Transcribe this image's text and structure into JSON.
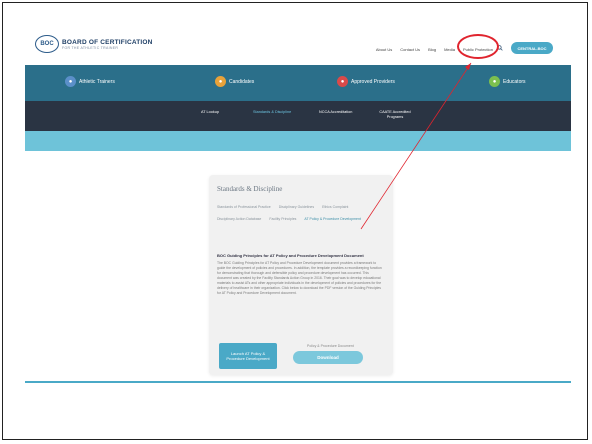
{
  "header": {
    "logo_mark": "BOC",
    "logo_name": "BOARD OF CERTIFICATION",
    "logo_sub": "FOR THE ATHLETIC TRAINER",
    "nav": [
      "About Us",
      "Contact Us",
      "Blog",
      "Media",
      "Public Protection"
    ],
    "portal_label": "CENTRAL.BOC"
  },
  "primary_nav": [
    {
      "label": "Athletic Trainers",
      "icon": "athlete-icon",
      "color": "#5b8fc9"
    },
    {
      "label": "Candidates",
      "icon": "candidate-icon",
      "color": "#e8a23a"
    },
    {
      "label": "Approved Providers",
      "icon": "provider-icon",
      "color": "#d94a4a"
    },
    {
      "label": "Educators",
      "icon": "educator-icon",
      "color": "#7cbf4f"
    }
  ],
  "sub_nav": [
    {
      "label": "AT Lookup"
    },
    {
      "label": "Standards & Discipline"
    },
    {
      "label": "NCCA Accreditation"
    },
    {
      "label": "CAATE Accredited Programs"
    }
  ],
  "card": {
    "title": "Standards & Discipline",
    "tabs_row1": [
      "Standards of Professional Practice",
      "Disciplinary Guidelines",
      "Ethics Complaint"
    ],
    "tabs_row2": [
      "Disciplinary Action Database",
      "Facility Principles",
      "AT Policy & Procedure Development"
    ],
    "heading": "BOC Guiding Principles for AT Policy and Procedure Development Document",
    "body": "The BOC Guiding Principles for AT Policy and Procedure Development document provides a framework to guide the development of policies and procedures. In addition, the template provides a recordkeeping function for demonstrating that thorough and defensible policy and procedure development has occurred. This document was created by the Facility Standards Action Group in 2016. Their goal was to develop educational materials to assist ATs and other appropriate individuals in the development of policies and procedures for the delivery of healthcare in their organization. Click below to download the PDF version of the Guiding Principles for AT Policy and Procedure Development document.",
    "launch_label": "Launch AT Policy & Procedure Development",
    "download_caption": "Policy & Procedure Document",
    "download_label": "Download"
  },
  "colors": {
    "band_primary": "#2b6f8a",
    "band_secondary": "#2a3443",
    "band_accent": "#6ec3d9",
    "annotation": "#e0242e"
  }
}
